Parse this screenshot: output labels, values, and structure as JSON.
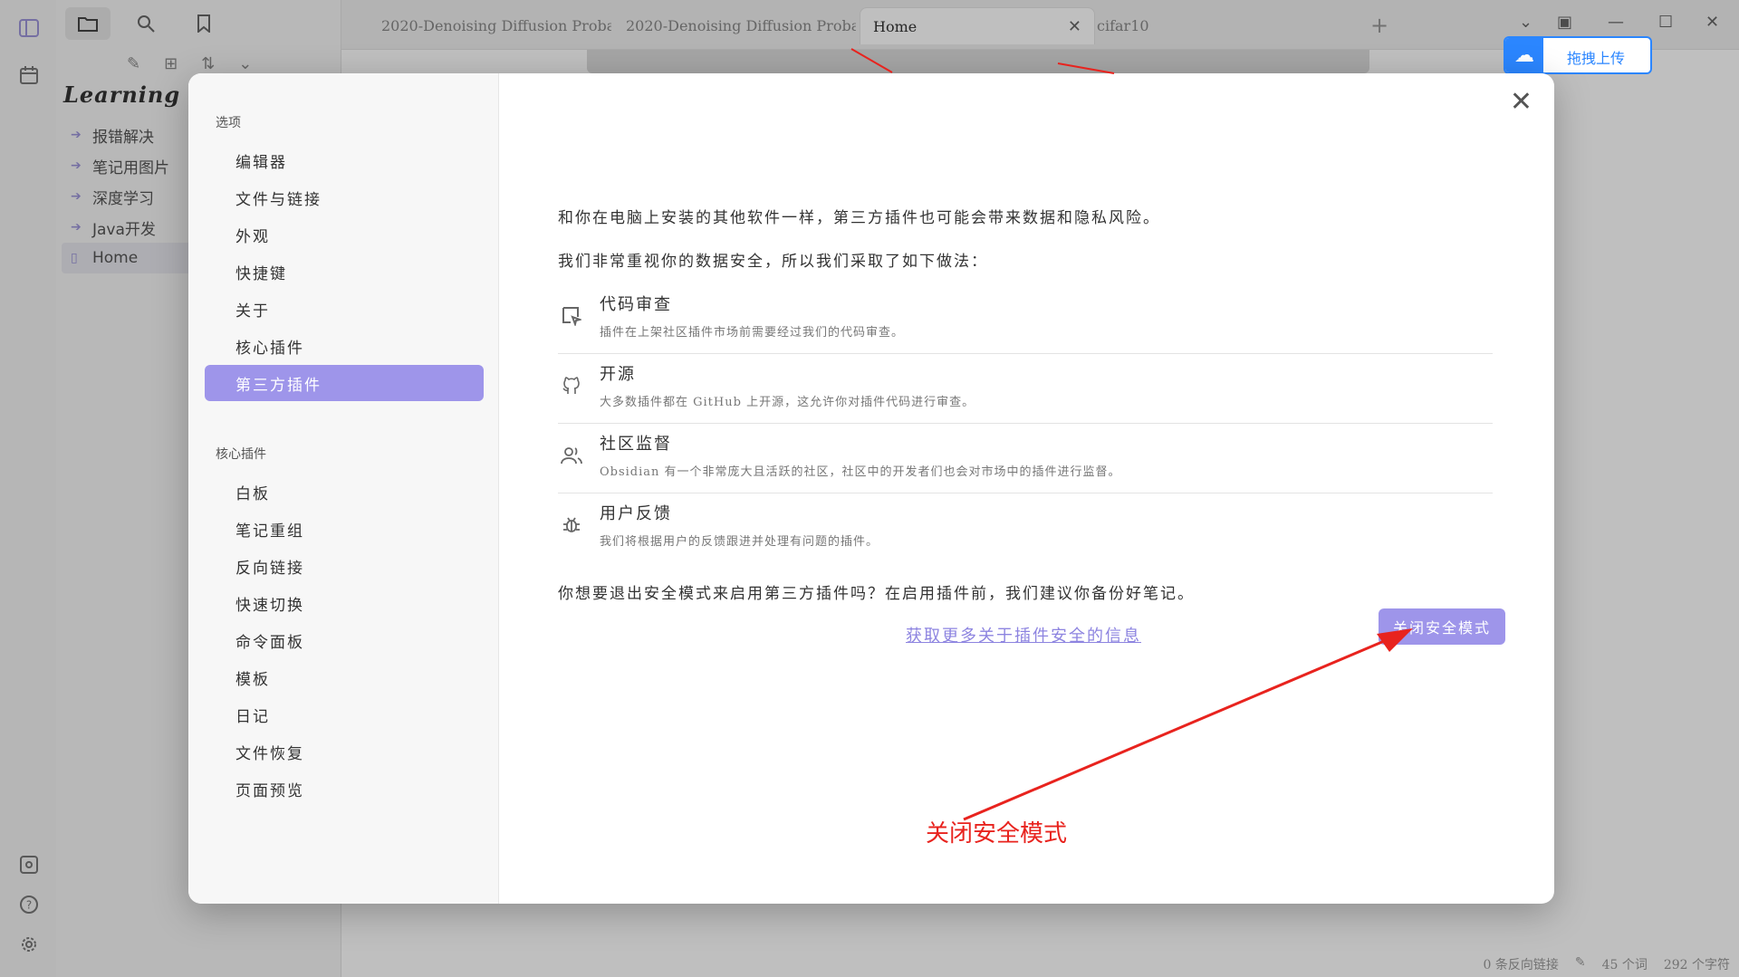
{
  "ribbon": {
    "icons": [
      "sidebar-toggle-icon",
      "calendar-icon",
      "vault-icon",
      "help-icon",
      "settings-icon"
    ]
  },
  "sidebar": {
    "vault_title": "Learning",
    "items": [
      {
        "label": "报错解决"
      },
      {
        "label": "笔记用图片"
      },
      {
        "label": "深度学习"
      },
      {
        "label": "Java开发"
      },
      {
        "label": "Home"
      }
    ]
  },
  "tabs": [
    {
      "label": "2020-Denoising Diffusion Proba···"
    },
    {
      "label": "2020-Denoising Diffusion Proba···"
    },
    {
      "label": "Home"
    },
    {
      "label": "cifar10"
    }
  ],
  "baidu": {
    "label": "拖拽上传"
  },
  "status": {
    "backlinks": "0 条反向链接",
    "words": "45 个词",
    "chars": "292 个字符"
  },
  "modal": {
    "nav_groups": {
      "options": "选项",
      "core_plugins": "核心插件"
    },
    "options_items": [
      {
        "label": "编辑器"
      },
      {
        "label": "文件与链接"
      },
      {
        "label": "外观"
      },
      {
        "label": "快捷键"
      },
      {
        "label": "关于"
      },
      {
        "label": "核心插件"
      },
      {
        "label": "第三方插件"
      }
    ],
    "core_items": [
      {
        "label": "白板"
      },
      {
        "label": "笔记重组"
      },
      {
        "label": "反向链接"
      },
      {
        "label": "快速切换"
      },
      {
        "label": "命令面板"
      },
      {
        "label": "模板"
      },
      {
        "label": "日记"
      },
      {
        "label": "文件恢复"
      },
      {
        "label": "页面预览"
      }
    ],
    "intro1": "和你在电脑上安装的其他软件一样，第三方插件也可能会带来数据和隐私风险。",
    "intro2": "我们非常重视你的数据安全，所以我们采取了如下做法：",
    "features": [
      {
        "title": "代码审查",
        "desc": "插件在上架社区插件市场前需要经过我们的代码审查。"
      },
      {
        "title": "开源",
        "desc": "大多数插件都在 GitHub 上开源，这允许你对插件代码进行审查。"
      },
      {
        "title": "社区监督",
        "desc": "Obsidian 有一个非常庞大且活跃的社区，社区中的开发者们也会对市场中的插件进行监督。"
      },
      {
        "title": "用户反馈",
        "desc": "我们将根据用户的反馈跟进并处理有问题的插件。"
      }
    ],
    "question": "你想要退出安全模式来启用第三方插件吗？在启用插件前，我们建议你备份好笔记。",
    "link": "获取更多关于插件安全的信息",
    "primary_button": "关闭安全模式"
  },
  "annotation": {
    "label": "关闭安全模式",
    "color": "#e8231e"
  },
  "colors": {
    "accent": "#9e95ea",
    "link": "#8d84e0",
    "annotation": "#e8231e"
  }
}
